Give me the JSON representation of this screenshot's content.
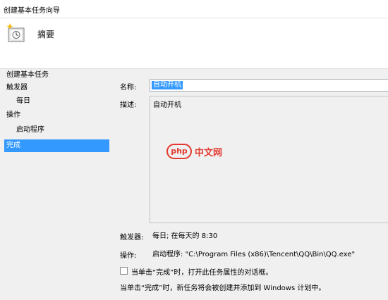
{
  "window": {
    "title": "创建基本任务向导"
  },
  "header": {
    "heading": "摘要",
    "icon": "task-wizard-icon"
  },
  "nav": {
    "items": [
      {
        "label": "创建基本任务"
      },
      {
        "label": "触发器"
      },
      {
        "label": "每日"
      },
      {
        "label": "操作"
      },
      {
        "label": "启动程序"
      },
      {
        "label": "完成"
      }
    ]
  },
  "summary": {
    "name_label": "名称:",
    "name_value": "自动开机",
    "desc_label": "描述:",
    "desc_value": "自动开机",
    "trigger_label": "触发器:",
    "trigger_value": "每日; 在每天的 8:30",
    "action_label": "操作:",
    "action_value": "启动程序: \"C:\\Program Files (x86)\\Tencent\\QQ\\Bin\\QQ.exe\""
  },
  "footer": {
    "checkbox_label": "当单击“完成”时，打开此任务属性的对话框。",
    "info": "当单击“完成”时，新任务将会被创建并添加到 Windows 计划中。"
  },
  "watermark": {
    "logo_text": "php",
    "text": "中文网"
  },
  "colors": {
    "selection": "#3399ff",
    "watermark": "#e33a2e"
  }
}
